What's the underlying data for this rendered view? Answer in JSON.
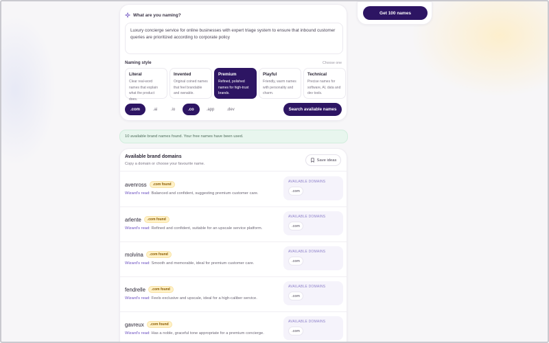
{
  "header": {
    "cta_label": "Get 100 names"
  },
  "form": {
    "question": "What are you naming?",
    "question_icon": "sparkle-icon",
    "description": "Luxury concierge service for online businesses with expert triage system to ensure that inbound customer queries are prioritized according to corporate policy",
    "naming_style_label": "Naming style",
    "choose_hint": "Choose one",
    "styles": [
      {
        "title": "Literal",
        "desc": "Clear real-word names that explain what the product does.",
        "selected": false
      },
      {
        "title": "Invented",
        "desc": "Original coined names that feel brandable and ownable.",
        "selected": false
      },
      {
        "title": "Premium",
        "desc": "Refined, polished names for high-trust brands.",
        "selected": true
      },
      {
        "title": "Playful",
        "desc": "Friendly, warm names with personality and charm.",
        "selected": false
      },
      {
        "title": "Technical",
        "desc": "Precise names for software, AI, data and dev tools.",
        "selected": false
      }
    ],
    "tlds": [
      {
        "label": ".com",
        "selected": true
      },
      {
        "label": ".ai",
        "selected": false
      },
      {
        "label": ".io",
        "selected": false
      },
      {
        "label": ".co",
        "selected": true
      },
      {
        "label": ".app",
        "selected": false
      },
      {
        "label": ".dev",
        "selected": false
      }
    ],
    "search_label": "Search available names"
  },
  "banner": {
    "text": "10 available brand names found. Your free names have been used."
  },
  "results": {
    "title": "Available brand domains",
    "subtitle": "Copy a domain or choose your favourite name.",
    "save_label": "Save ideas",
    "save_icon": "bookmark-icon",
    "available_label": "AVAILABLE DOMAINS",
    "wizard_label": "Wizard's read:",
    "items": [
      {
        "name": "avenross",
        "badge": ".com found",
        "read": "Balanced and confident, suggesting premium customer care.",
        "domain": ".com"
      },
      {
        "name": "arlente",
        "badge": ".com found",
        "read": "Refined and confident, suitable for an upscale service platform.",
        "domain": ".com"
      },
      {
        "name": "molvina",
        "badge": ".com found",
        "read": "Smooth and memorable, ideal for premium customer care.",
        "domain": ".com"
      },
      {
        "name": "fendrelle",
        "badge": ".com found",
        "read": "Feels exclusive and upscale, ideal for a high-caliber service.",
        "domain": ".com"
      },
      {
        "name": "gavreux",
        "badge": ".com found",
        "read": "Has a noble, graceful tone appropriate for a premium concierge.",
        "domain": ".com"
      }
    ]
  },
  "colors": {
    "brand": "#2d1563",
    "success_bg": "#e8f6ee",
    "badge_bg": "#fff1c7"
  }
}
